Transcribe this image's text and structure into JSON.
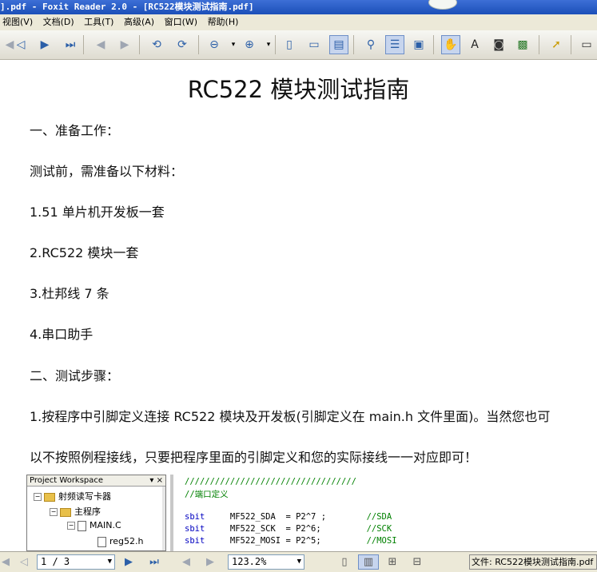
{
  "window": {
    "title": "].pdf - Foxit Reader 2.0 - [RC522模块测试指南.pdf]"
  },
  "menu": [
    "视图(V)",
    "文档(D)",
    "工具(T)",
    "高级(A)",
    "窗口(W)",
    "帮助(H)"
  ],
  "toolbar": {
    "icons": [
      "first-page-icon",
      "prev-page-icon",
      "next-page-icon",
      "last-page-icon",
      "back-icon",
      "forward-icon",
      "rotate-left-icon",
      "rotate-right-icon",
      "zoom-out-icon",
      "zoom-in-icon",
      "actual-size-icon",
      "fit-page-icon",
      "fit-width-icon",
      "find-icon",
      "bookmark-pane-icon",
      "thumbnail-pane-icon",
      "hand-tool-icon",
      "select-text-icon",
      "snapshot-icon",
      "image-select-icon",
      "pointer-icon",
      "annotation-icon"
    ]
  },
  "document": {
    "title": "RC522 模块测试指南",
    "lines": [
      "一、准备工作：",
      "测试前，需准备以下材料：",
      "1.51 单片机开发板一套",
      "2.RC522 模块一套",
      "3.杜邦线 7 条",
      "4.串口助手",
      "二、测试步骤：",
      "1.按程序中引脚定义连接 RC522 模块及开发板(引脚定义在 main.h 文件里面)。当然您也可",
      "以不按照例程接线，只要把程序里面的引脚定义和您的实际接线一一对应即可！"
    ],
    "figure": {
      "panel_title": "Project Workspace",
      "panel_controls": "▾ ×",
      "tree": [
        "射频读写卡器",
        "主程序",
        "MAIN.C",
        "reg52.h"
      ],
      "code": [
        {
          "kw": "",
          "text": "//////////////////////////////////",
          "comment": ""
        },
        {
          "kw": "",
          "text": "//端口定义",
          "comment": ""
        },
        {
          "kw": "sbit",
          "text": "     MF522_SDA  = P2^7 ;",
          "comment": "        //SDA"
        },
        {
          "kw": "sbit",
          "text": "     MF522_SCK  = P2^6;",
          "comment": "         //SCK"
        },
        {
          "kw": "sbit",
          "text": "     MF522_MOSI = P2^5;",
          "comment": "         //MOSI"
        }
      ]
    }
  },
  "statusbar": {
    "page": "1 / 3",
    "zoom": "123.2%",
    "file_label": "文件: RC522模块测试指南.pdf"
  }
}
